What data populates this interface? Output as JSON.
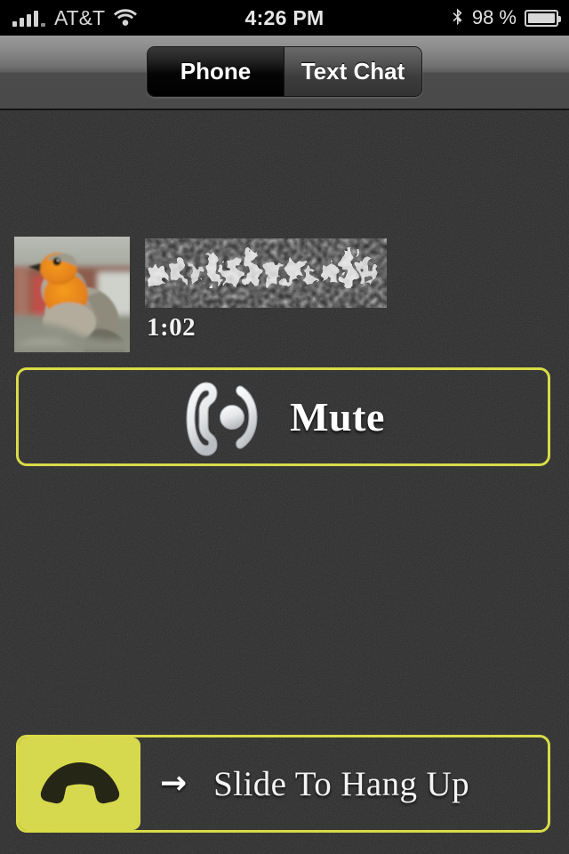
{
  "status_bar": {
    "carrier": "AT&T",
    "signal_icon": "signal-bars-icon",
    "wifi_icon": "wifi-icon",
    "time": "4:26 PM",
    "bluetooth_icon": "bluetooth-icon",
    "battery_percent": "98 %",
    "battery_icon": "battery-icon",
    "battery_level": 98
  },
  "toolbar": {
    "segments": [
      {
        "label": "Phone",
        "selected": true
      },
      {
        "label": "Text Chat",
        "selected": false
      }
    ]
  },
  "call": {
    "avatar_icon": "contact-avatar-robin-photo",
    "contact_name": "",
    "contact_name_state": "redacted",
    "duration": "1:02"
  },
  "mute": {
    "label": "Mute",
    "icon": "phone-mute-icon",
    "border_color": "#d9dc46"
  },
  "hangup": {
    "label": "Slide To Hang Up",
    "arrow": "→",
    "thumb_icon": "end-call-handset-icon",
    "thumb_color": "#d8db48",
    "border_color": "#d9dc46"
  },
  "theme": {
    "accent_yellow": "#d9dc46",
    "background_dark": "#2b2b2b",
    "toolbar_gray": "#4a4a4a",
    "text_white": "#ffffff"
  }
}
